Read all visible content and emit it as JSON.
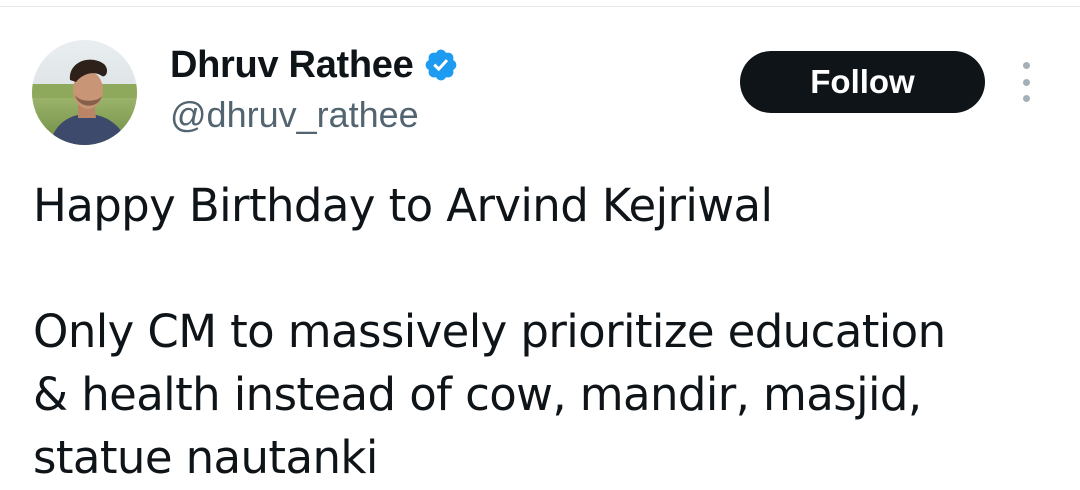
{
  "author": {
    "display_name": "Dhruv Rathee",
    "handle": "@dhruv_rathee",
    "verified": true,
    "verified_icon": "verified-badge-icon",
    "avatar_icon": "profile-avatar"
  },
  "actions": {
    "follow_label": "Follow",
    "more_icon": "more-vertical-icon"
  },
  "tweet": {
    "paragraph_1": "Happy Birthday to Arvind Kejriwal",
    "paragraph_2_line_1": "Only CM to massively prioritize education",
    "paragraph_2_line_2": "& health instead of cow, mandir, masjid,",
    "paragraph_2_line_3": "statue nautanki"
  },
  "colors": {
    "text_primary": "#0f1419",
    "text_secondary": "#536471",
    "verified_blue": "#1d9bf0",
    "button_bg": "#0f1419",
    "button_text": "#ffffff"
  }
}
